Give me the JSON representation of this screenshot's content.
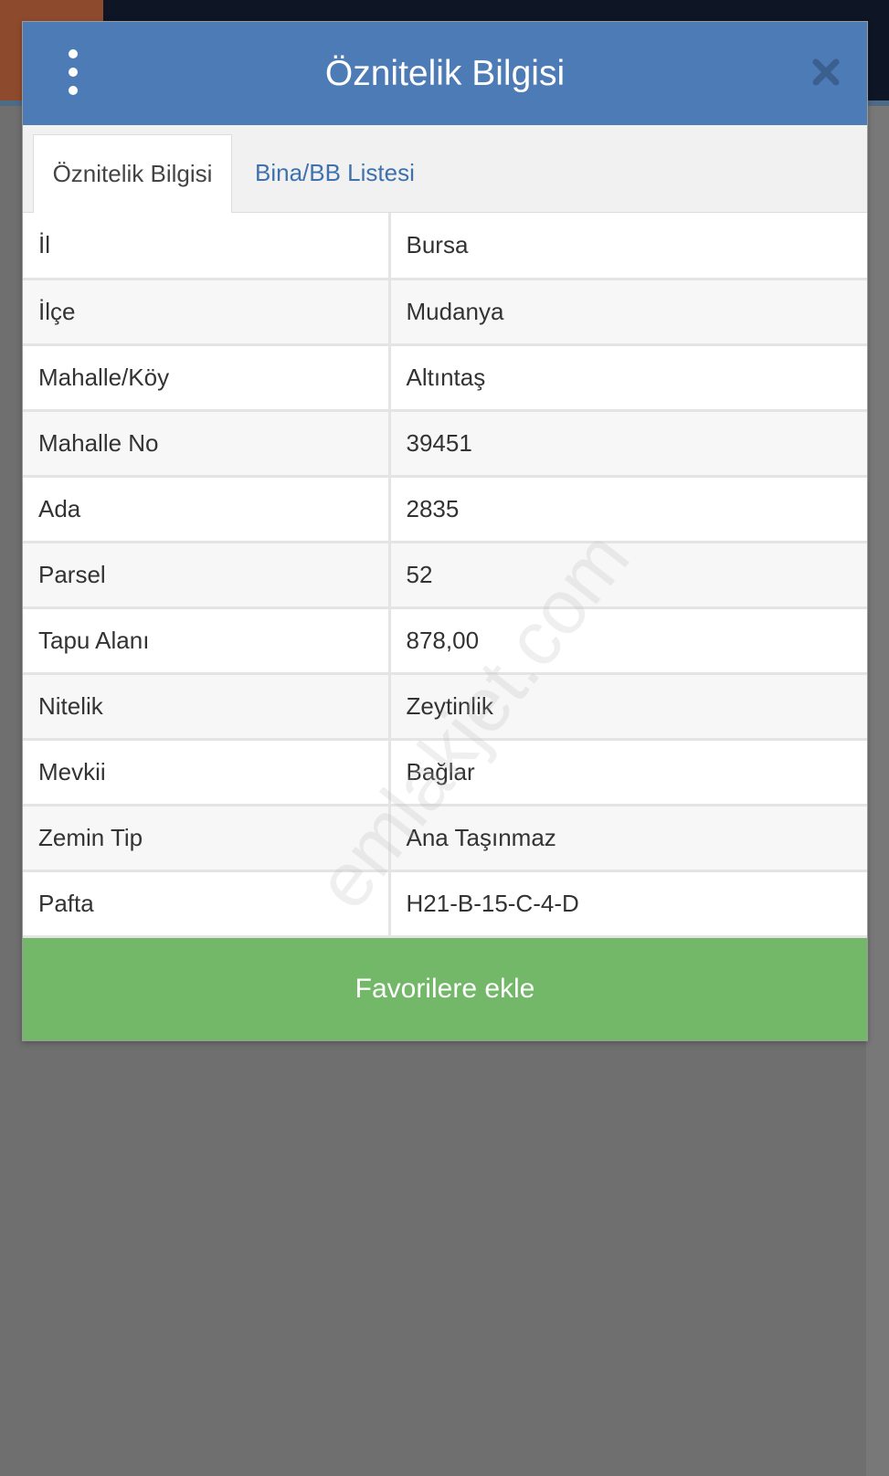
{
  "modal": {
    "title": "Öznitelik Bilgisi",
    "menu_icon": "vertical-dots-icon",
    "close_icon": "close-icon"
  },
  "tabs": [
    {
      "label": "Öznitelik Bilgisi",
      "active": true
    },
    {
      "label": "Bina/BB Listesi",
      "active": false
    }
  ],
  "attributes": [
    {
      "key": "İl",
      "value": "Bursa"
    },
    {
      "key": "İlçe",
      "value": "Mudanya"
    },
    {
      "key": "Mahalle/Köy",
      "value": "Altıntaş"
    },
    {
      "key": "Mahalle No",
      "value": "39451"
    },
    {
      "key": "Ada",
      "value": "2835"
    },
    {
      "key": "Parsel",
      "value": "52"
    },
    {
      "key": "Tapu Alanı",
      "value": "878,00"
    },
    {
      "key": "Nitelik",
      "value": "Zeytinlik"
    },
    {
      "key": "Mevkii",
      "value": "Bağlar"
    },
    {
      "key": "Zemin Tip",
      "value": "Ana Taşınmaz"
    },
    {
      "key": "Pafta",
      "value": "H21-B-15-C-4-D"
    }
  ],
  "favorite_button": {
    "label": "Favorilere ekle"
  },
  "watermark": "emlakjet.com",
  "colors": {
    "header": "#4d7bb5",
    "tab_link": "#3f72ad",
    "favorite_button": "#72b868",
    "overlay": "#6f6f6f"
  }
}
